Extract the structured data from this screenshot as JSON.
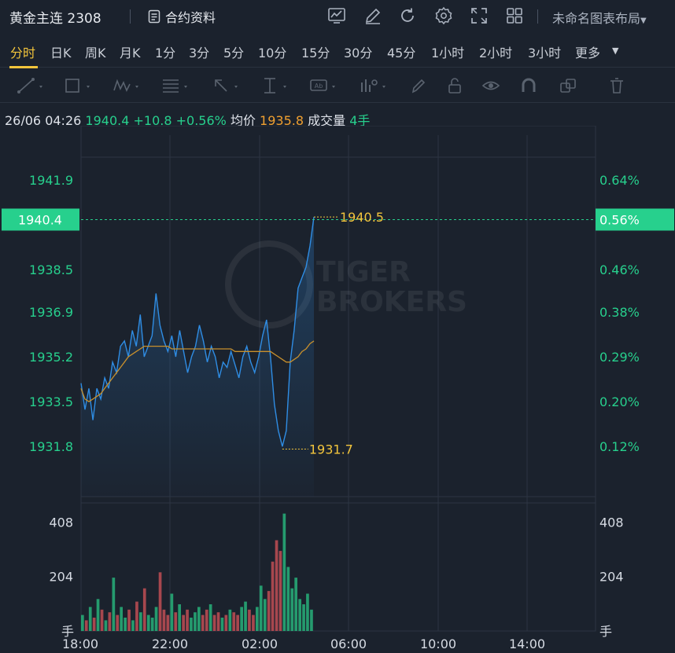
{
  "header": {
    "title": "黄金主连 2308",
    "contract_label": "合约资料",
    "layout_label": "未命名图表布局"
  },
  "toolbar_icons": [
    "chart-icon",
    "edit-icon",
    "refresh-icon",
    "settings-icon",
    "fullscreen-icon",
    "grid-icon"
  ],
  "timeframes": [
    "分时",
    "日K",
    "周K",
    "月K",
    "1分",
    "3分",
    "5分",
    "10分",
    "15分",
    "30分",
    "45分",
    "1小时",
    "2小时",
    "3小时",
    "更多"
  ],
  "active_timeframe": "分时",
  "drawing_tools": [
    "line-tool-icon",
    "rect-tool-icon",
    "wave-tool-icon",
    "fib-tool-icon",
    "arrow-tool-icon",
    "measure-tool-icon",
    "text-tool-icon",
    "indicator-tool-icon",
    "pen-icon",
    "lock-icon",
    "eye-icon",
    "magnet-icon",
    "layers-icon",
    "trash-icon"
  ],
  "info": {
    "datetime": "26/06 04:26",
    "price": "1940.4",
    "change": "+10.8",
    "change_pct": "+0.56%",
    "avg_label": "均价",
    "avg_value": "1935.8",
    "volume_label": "成交量",
    "volume_value": "4手"
  },
  "price_axis": {
    "left_labels": [
      "1941.9",
      "1938.5",
      "1936.9",
      "1935.2",
      "1933.5",
      "1931.8"
    ],
    "right_labels": [
      "0.64%",
      "0.46%",
      "0.38%",
      "0.29%",
      "0.20%",
      "0.12%"
    ],
    "current_price": "1940.4",
    "current_pct": "0.56%"
  },
  "annotations": {
    "high": "1940.5",
    "low": "1931.7"
  },
  "volume_axis": {
    "left_labels": [
      "408",
      "204"
    ],
    "right_labels": [
      "408",
      "204"
    ],
    "unit": "手"
  },
  "time_axis": [
    "18:00",
    "22:00",
    "02:00",
    "06:00",
    "10:00",
    "14:00"
  ],
  "watermark": "TIGER BROKERS",
  "colors": {
    "up": "#27d08d",
    "price_line": "#2f8de4",
    "avg_line": "#c8902c",
    "accent": "#f3c53c",
    "background": "#1b222d"
  },
  "chart_data": {
    "type": "line",
    "title": "",
    "xlabel": "",
    "ylabel": "",
    "ylim": [
      1929.9,
      1943.6
    ],
    "x_ticks": [
      "18:00",
      "22:00",
      "02:00",
      "06:00",
      "10:00",
      "14:00"
    ],
    "series": [
      {
        "values": [
          1934.2,
          1933.2,
          1934.0,
          1932.8,
          1934.0,
          1933.6,
          1934.4,
          1934.0,
          1935.0,
          1934.6,
          1935.6,
          1935.8,
          1935.2,
          1936.2,
          1935.6,
          1936.8,
          1935.2,
          1935.6,
          1936.0,
          1937.6,
          1936.4,
          1935.8,
          1935.4,
          1936.0,
          1935.2,
          1936.2,
          1935.4,
          1934.6,
          1935.2,
          1935.6,
          1936.4,
          1935.8,
          1935.0,
          1935.6,
          1935.2,
          1934.4,
          1935.0,
          1934.8,
          1935.4,
          1934.9,
          1934.4,
          1935.2,
          1935.6,
          1935.0,
          1934.6,
          1935.2,
          1936.0,
          1936.6,
          1935.2,
          1933.4,
          1932.4,
          1931.8,
          1932.4,
          1935.0,
          1936.2,
          1937.8,
          1938.2,
          1938.6,
          1939.4,
          1940.5
        ],
        "color": "#2f8de4"
      },
      {
        "values": [
          1934.0,
          1933.6,
          1933.5,
          1933.6,
          1933.7,
          1933.8,
          1934.0,
          1934.2,
          1934.4,
          1934.6,
          1934.8,
          1935.0,
          1935.2,
          1935.3,
          1935.4,
          1935.5,
          1935.6,
          1935.6,
          1935.6,
          1935.6,
          1935.6,
          1935.6,
          1935.6,
          1935.5,
          1935.5,
          1935.5,
          1935.5,
          1935.5,
          1935.5,
          1935.5,
          1935.5,
          1935.5,
          1935.5,
          1935.5,
          1935.5,
          1935.5,
          1935.5,
          1935.5,
          1935.5,
          1935.4,
          1935.4,
          1935.4,
          1935.4,
          1935.4,
          1935.4,
          1935.4,
          1935.4,
          1935.4,
          1935.4,
          1935.3,
          1935.2,
          1935.1,
          1935.0,
          1935.0,
          1935.1,
          1935.2,
          1935.4,
          1935.5,
          1935.7,
          1935.8
        ],
        "color": "#c8902c"
      }
    ],
    "volume": [
      60,
      40,
      90,
      50,
      120,
      80,
      40,
      70,
      200,
      60,
      90,
      50,
      80,
      40,
      110,
      70,
      160,
      60,
      50,
      90,
      220,
      80,
      60,
      140,
      70,
      100,
      60,
      80,
      50,
      70,
      90,
      60,
      80,
      100,
      60,
      70,
      50,
      60,
      80,
      70,
      60,
      90,
      110,
      80,
      60,
      90,
      170,
      120,
      150,
      260,
      340,
      300,
      440,
      240,
      160,
      200,
      120,
      100,
      140,
      80
    ],
    "volume_ylim": [
      0,
      480
    ]
  }
}
